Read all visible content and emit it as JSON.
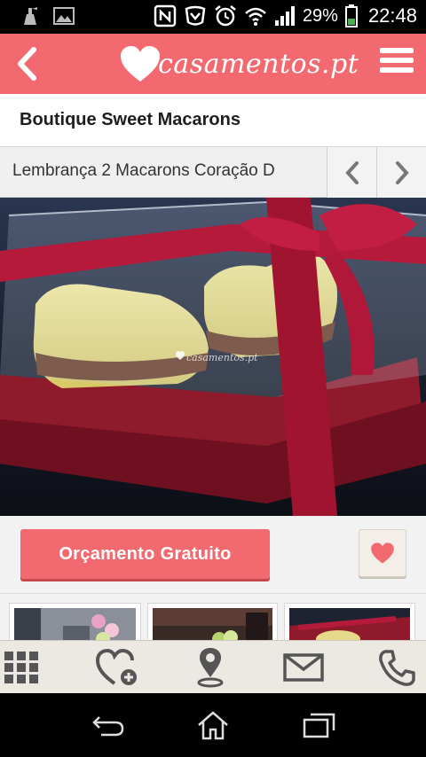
{
  "status_bar": {
    "battery_percent": "29%",
    "time": "22:48",
    "icons": [
      "cleaner-icon",
      "image-icon",
      "nfc-icon",
      "shield-icon",
      "alarm-icon",
      "wifi-icon",
      "signal-icon",
      "battery-icon"
    ]
  },
  "app_bar": {
    "logo_text": "casamentos.pt",
    "back_icon": "chevron-left-icon",
    "menu_icon": "hamburger-menu-icon"
  },
  "vendor": {
    "name": "Boutique Sweet Macarons"
  },
  "item": {
    "title": "Lembrança 2 Macarons Coração D",
    "prev_icon": "chevron-left-icon",
    "next_icon": "chevron-right-icon"
  },
  "photo": {
    "watermark": "casamentos.pt"
  },
  "actions": {
    "quote_label": "Orçamento Gratuito",
    "favorite_icon": "heart-icon"
  },
  "bottom_nav": {
    "items": [
      "grid-icon",
      "add-favorite-icon",
      "map-pin-icon",
      "mail-icon",
      "phone-icon"
    ]
  },
  "colors": {
    "brand": "#f26a6f",
    "brand_dark": "#c9484e",
    "bottom_bar": "#ece8e2"
  }
}
